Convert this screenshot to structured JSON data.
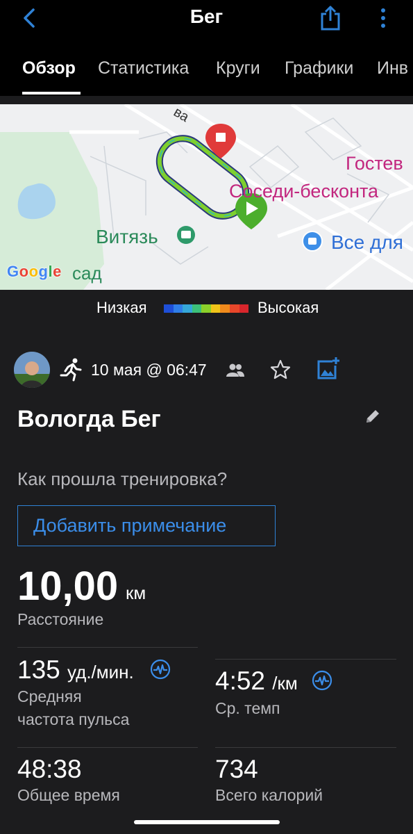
{
  "header": {
    "title": "Бег"
  },
  "tabs": [
    "Обзор",
    "Статистика",
    "Круги",
    "Графики",
    "Инв"
  ],
  "map": {
    "labels": {
      "street": "ва",
      "guest": "Гостев",
      "neighbors": "Соседи-бесконта",
      "vityaz": "Витязь",
      "all_for": "Все для",
      "sad": "сад",
      "google": "Google"
    }
  },
  "legend": {
    "low": "Низкая",
    "high": "Высокая",
    "colors": [
      "#1e4fd8",
      "#2f7ee8",
      "#35a7d9",
      "#3cc07a",
      "#8bd02a",
      "#f0c419",
      "#f08a1c",
      "#e8472a",
      "#d8262c"
    ]
  },
  "activity": {
    "date": "10 мая @ 06:47",
    "title": "Вологда Бег",
    "question": "Как прошла тренировка?",
    "add_note": "Добавить примечание"
  },
  "distance": {
    "value": "10,00",
    "unit": "км",
    "label": "Расстояние"
  },
  "stats": {
    "hr": {
      "value": "135",
      "unit": "уд./мин.",
      "label_line1": "Средняя",
      "label_line2": "частота пульса"
    },
    "pace": {
      "value": "4:52",
      "unit": "/км",
      "label": "Ср. темп"
    },
    "time": {
      "value": "48:38",
      "label": "Общее время"
    },
    "calories": {
      "value": "734",
      "label": "Всего калорий"
    }
  },
  "colors": {
    "accent": "#2f82d6",
    "background": "#1c1c1e"
  }
}
